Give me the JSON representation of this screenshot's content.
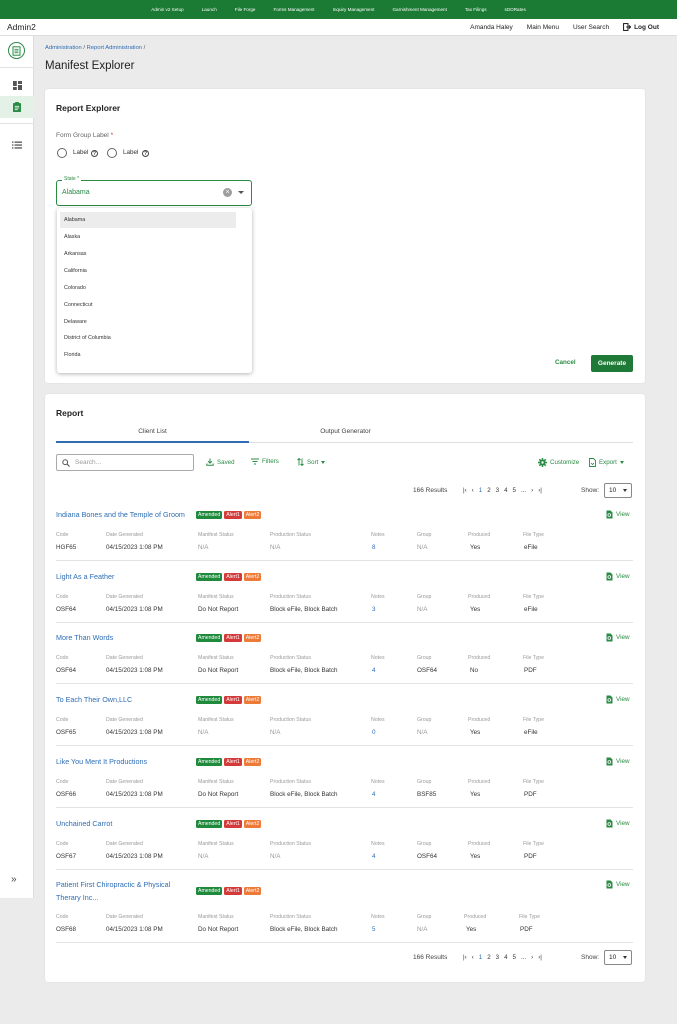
{
  "topnav": [
    "Admin v2 Setup",
    "Launch",
    "File Forge",
    "Forms Management",
    "Inquiry Management",
    "Garnishment Management",
    "Tax Filings",
    "sDORates"
  ],
  "header": {
    "brand": "Admin2",
    "user": "Amanda Haley",
    "main_menu": "Main Menu",
    "user_search": "User Search",
    "logout": "Log Out"
  },
  "breadcrumb": {
    "item1": "Administration",
    "item2": "Report Administration",
    "sep": "/"
  },
  "page_title": "Manifest Explorer",
  "explorer": {
    "title": "Report Explorer",
    "form_group_label": "Form Group Label",
    "required_mark": "*",
    "radio1": "Label",
    "radio2": "Label",
    "state_label": "State *",
    "state_value": "Alabama",
    "options": [
      "Alabama",
      "Alaska",
      "Arkansas",
      "California",
      "Colorado",
      "Connecticut",
      "Delaware",
      "District of Columbia",
      "Florida"
    ],
    "cancel": "Cancel",
    "generate": "Generate"
  },
  "report": {
    "title": "Report",
    "tabs": [
      "Client List",
      "Output Generator"
    ],
    "search_placeholder": "Search...",
    "saved": "Saved",
    "filters": "Filters",
    "sort": "Sort",
    "customize": "Customize",
    "export": "Export",
    "results": "166 Results",
    "pages": [
      "1",
      "2",
      "3",
      "4",
      "5",
      "..."
    ],
    "show_label": "Show:",
    "show_value": "10",
    "view": "View",
    "field_labels": {
      "code": "Code",
      "date": "Date Generated",
      "manifest": "Manifest Status",
      "production": "Production Status",
      "notes": "Notes",
      "group": "Group",
      "produced": "Produced",
      "filetype": "File Type"
    },
    "badges": {
      "amended": "Amended",
      "alert1": "Alert1",
      "alert2": "Alert2"
    },
    "records": [
      {
        "name": "Indiana Bones and the Temple of Groom",
        "code": "HGF65",
        "date": "04/15/2023 1:08 PM",
        "manifest": "N/A",
        "production": "N/A",
        "notes": "8",
        "group": "N/A",
        "produced": "Yes",
        "filetype": "eFile"
      },
      {
        "name": "Light As a Feather",
        "code": "OSF64",
        "date": "04/15/2023 1:08 PM",
        "manifest": "Do Not Report",
        "production": "Block eFile, Block Batch",
        "notes": "3",
        "group": "N/A",
        "produced": "Yes",
        "filetype": "eFile"
      },
      {
        "name": "More Than Words",
        "code": "OSF64",
        "date": "04/15/2023 1:08 PM",
        "manifest": "Do Not Report",
        "production": "Block eFile, Block Batch",
        "notes": "4",
        "group": "OSF64",
        "produced": "No",
        "filetype": "PDF"
      },
      {
        "name": "To Each Their Own,LLC",
        "code": "OSF65",
        "date": "04/15/2023 1:08 PM",
        "manifest": "N/A",
        "production": "N/A",
        "notes": "0",
        "group": "N/A",
        "produced": "Yes",
        "filetype": "eFile"
      },
      {
        "name": "Like You Ment It Productions",
        "code": "OSF66",
        "date": "04/15/2023 1:08 PM",
        "manifest": "Do Not Report",
        "production": "Block eFile, Block Batch",
        "notes": "4",
        "group": "BSF85",
        "produced": "Yes",
        "filetype": "PDF"
      },
      {
        "name": "Unchained Carrot",
        "code": "OSF67",
        "date": "04/15/2023 1:08 PM",
        "manifest": "N/A",
        "production": "N/A",
        "notes": "4",
        "group": "OSF64",
        "produced": "Yes",
        "filetype": "PDF"
      },
      {
        "name": "Patient First Chiropractic & Physical Therary Inc...",
        "code": "OSF68",
        "date": "04/15/2023 1:08 PM",
        "manifest": "Do Not Report",
        "production": "Block eFile, Block Batch",
        "notes": "5",
        "group": "N/A",
        "produced": "Yes",
        "filetype": "PDF"
      }
    ]
  },
  "colors": {
    "brand_green": "#1b7a34",
    "accent_green": "#2a8b44",
    "link_blue": "#2e6db4",
    "alert_red": "#d43a3a",
    "alert_orange": "#ee7a38"
  }
}
